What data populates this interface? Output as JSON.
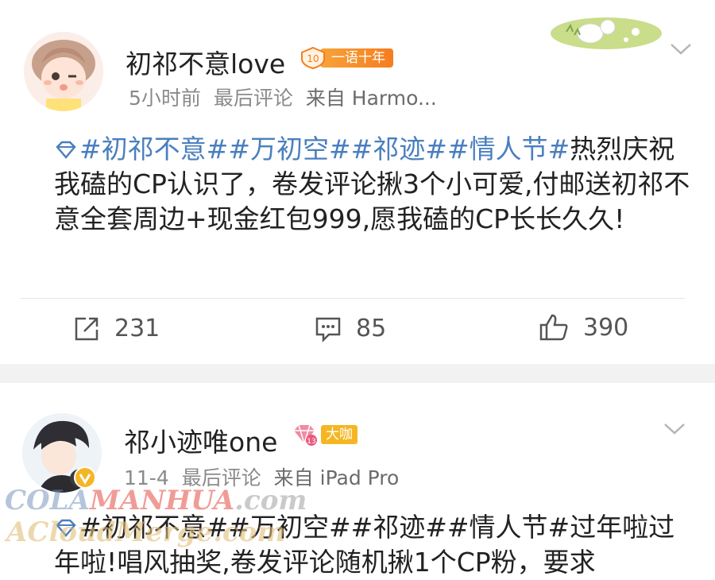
{
  "posts": [
    {
      "username": "初祁不意love",
      "badge_level": "10",
      "badge_label": "一语十年",
      "time": "5小时前",
      "status": "最后评论",
      "source": "来自 Harmo...",
      "tags": [
        "#初祁不意#",
        "#万初空#",
        "#祁迹#",
        "#情人节#"
      ],
      "text": "热烈庆祝我磕的CP认识了，卷发评论揪3个小可爱,付邮送初祁不意全套周边+现金红包999,愿我磕的CP长长久久!",
      "reposts": "231",
      "comments": "85",
      "likes": "390"
    },
    {
      "username": "祁小迹唯one",
      "vip_level": "13",
      "badge_label": "大咖",
      "time": "11-4",
      "status": "最后评论",
      "source": "来自 iPad Pro",
      "text_line1": "#初祁不意##万初空##祁迹##情人节#过年啦过",
      "text_line2": "年啦!唱风抽奖,卷发评论随机揪1个CP粉，要求"
    }
  ],
  "watermark": {
    "part1": "COLA",
    "part2": "MANHUA",
    "part3": ".com",
    "line2": "ACloudMerge.com"
  },
  "colors": {
    "tag": "#4a7fbf",
    "badge": "#f57d1f",
    "vip": "#f5b624",
    "separator": "#f2f2f2"
  }
}
